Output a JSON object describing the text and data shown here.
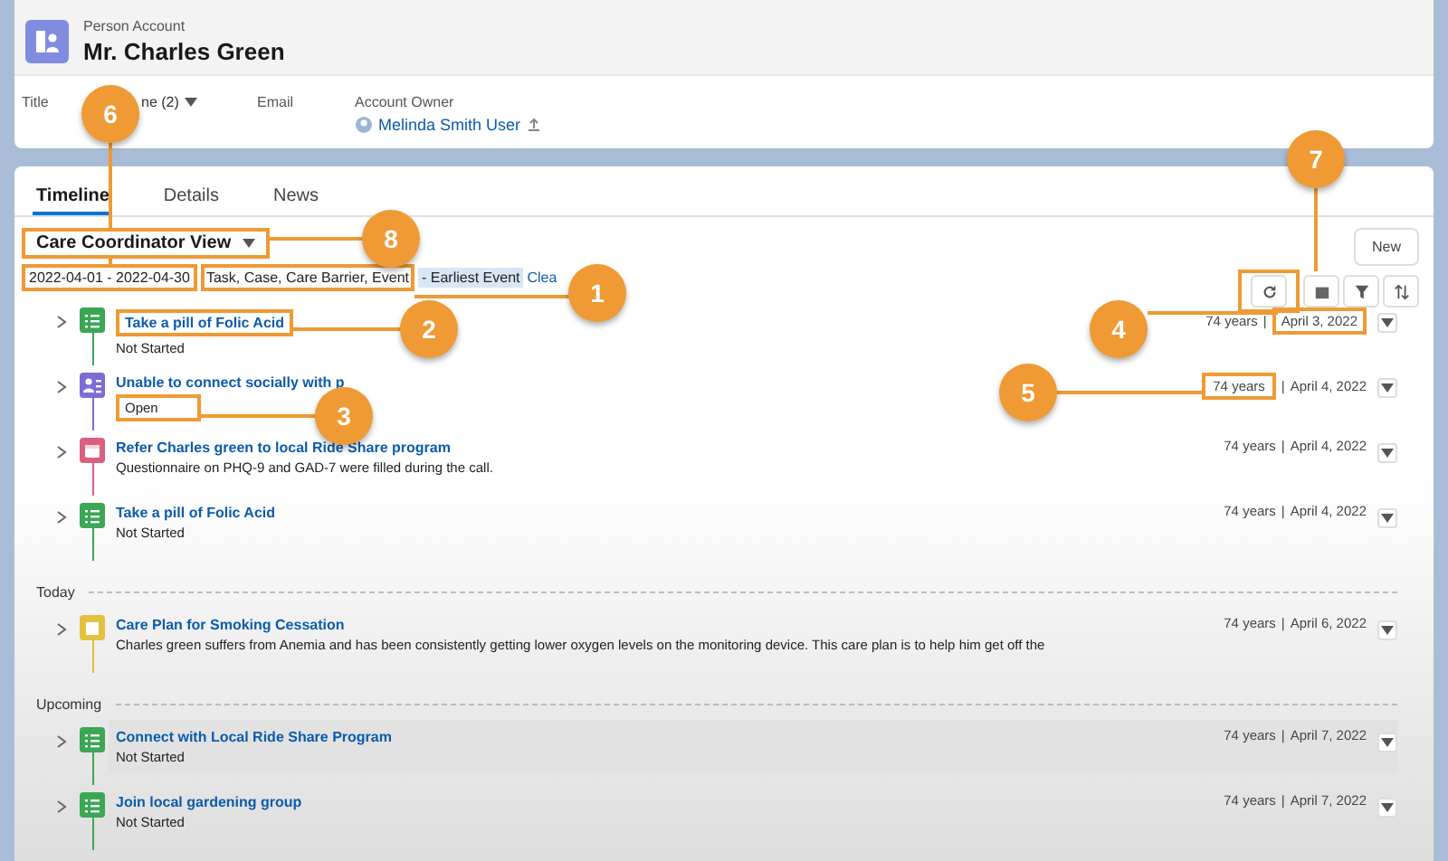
{
  "header": {
    "object_type": "Person Account",
    "name": "Mr. Charles Green"
  },
  "fields": [
    {
      "label": "Title"
    },
    {
      "value": "ne (2)",
      "dropdown": true
    },
    {
      "label": "Email"
    },
    {
      "label": "Account Owner",
      "value": "Melinda Smith User",
      "link": true
    }
  ],
  "tabs": [
    {
      "label": "Timeline",
      "selected": true
    },
    {
      "label": "Details",
      "selected": false
    },
    {
      "label": "News",
      "selected": false
    }
  ],
  "view_selector": {
    "label": "Care Coordinator View"
  },
  "filters": {
    "date_range": "2022-04-01 - 2022-04-30",
    "types": "Task, Case, Care Barrier, Event",
    "sort": "- Earliest Event",
    "clear_link": "Clea"
  },
  "new_button": "New",
  "timeline": [
    {
      "items": [
        {
          "kind": "task",
          "title": "Take a pill of Folic Acid",
          "subtitle": "Not Started",
          "age": "74 years",
          "separator": "|",
          "date": "April 3, 2022",
          "highlighted": false
        },
        {
          "kind": "case",
          "title": "Unable to connect socially with p",
          "subtitle": "Open",
          "age": "74 years",
          "separator": "|",
          "date": "April 4, 2022",
          "highlighted": false
        },
        {
          "kind": "event",
          "title": "Refer Charles green to local Ride Share program",
          "subtitle": "Questionnaire on PHQ-9 and GAD-7 were filled during the call.",
          "age": "74 years",
          "separator": "|",
          "date": "April 4, 2022",
          "highlighted": false
        },
        {
          "kind": "task",
          "title": "Take a pill of Folic Acid",
          "subtitle": "Not Started",
          "age": "74 years",
          "separator": "|",
          "date": "April 4, 2022",
          "highlighted": false
        }
      ]
    },
    {
      "label": "Today",
      "items": [
        {
          "kind": "careplan",
          "title": "Care Plan for Smoking Cessation",
          "subtitle": "Charles green suffers from Anemia and has been consistently getting lower oxygen levels on the monitoring device. This care plan is to help him get off the",
          "age": "74 years",
          "separator": "|",
          "date": "April 6, 2022",
          "highlighted": false
        }
      ]
    },
    {
      "label": "Upcoming",
      "items": [
        {
          "kind": "task",
          "title": "Connect with Local Ride Share Program",
          "subtitle": "Not Started",
          "age": "74 years",
          "separator": "|",
          "date": "April 7, 2022",
          "highlighted": true
        },
        {
          "kind": "task",
          "title": "Join local gardening group",
          "subtitle": "Not Started",
          "age": "74 years",
          "separator": "|",
          "date": "April 7, 2022",
          "highlighted": false
        }
      ]
    }
  ],
  "callouts": [
    {
      "label": "1"
    },
    {
      "label": "2"
    },
    {
      "label": "3"
    },
    {
      "label": "4"
    },
    {
      "label": "5"
    },
    {
      "label": "6"
    },
    {
      "label": "7"
    },
    {
      "label": "8"
    }
  ]
}
